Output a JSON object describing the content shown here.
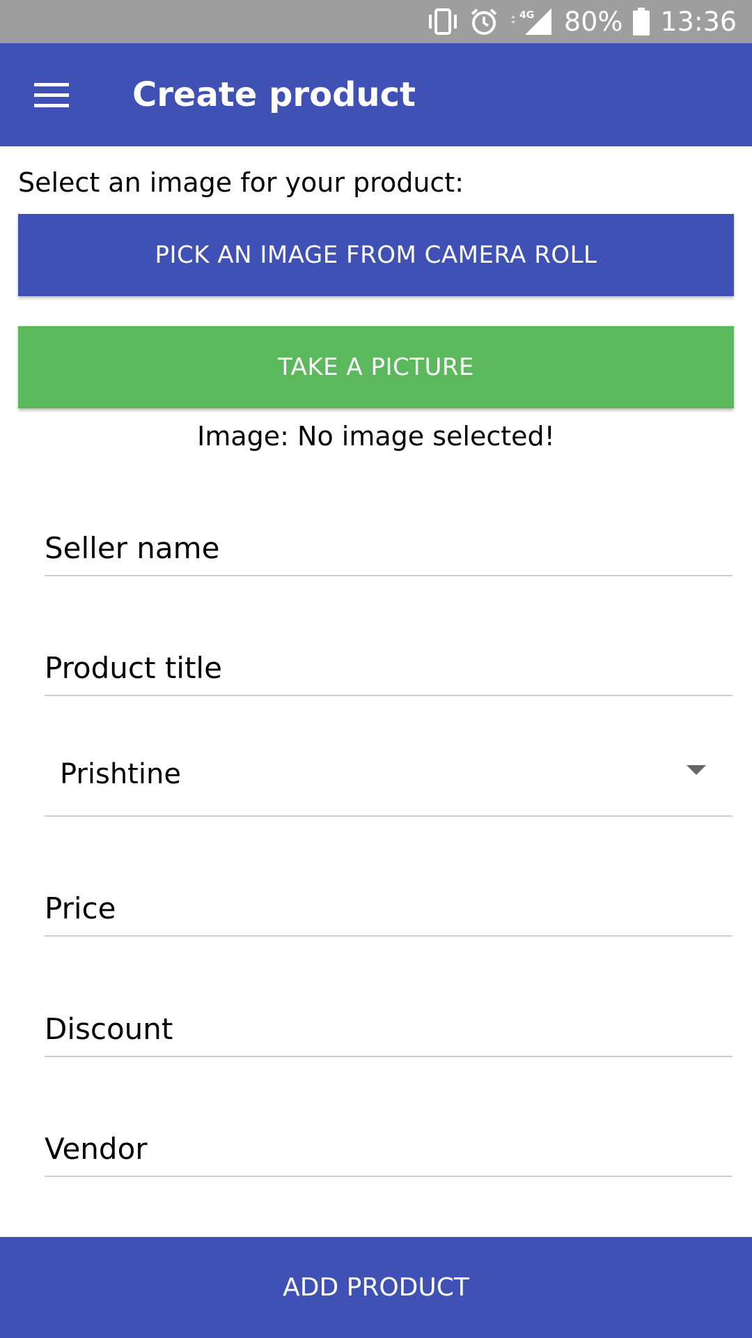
{
  "status_bar": {
    "battery": "80%",
    "time": "13:36",
    "network": "4G",
    "icons": [
      "vibrate-icon",
      "alarm-icon",
      "signal-icon",
      "battery-icon"
    ]
  },
  "app_bar": {
    "title": "Create product",
    "menu_icon": "hamburger-menu-icon",
    "color": "#3f51b5"
  },
  "image_section": {
    "label": "Select an image for your product:",
    "pick_button": "PICK AN IMAGE FROM CAMERA ROLL",
    "take_button": "TAKE A PICTURE",
    "status": "Image: No image selected!"
  },
  "form": {
    "seller_name": {
      "placeholder": "Seller name",
      "value": ""
    },
    "product_title": {
      "placeholder": "Product title",
      "value": ""
    },
    "city": {
      "selected": "Prishtine"
    },
    "price": {
      "placeholder": "Price",
      "value": ""
    },
    "discount": {
      "placeholder": "Discount",
      "value": ""
    },
    "vendor": {
      "placeholder": "Vendor",
      "value": ""
    }
  },
  "footer": {
    "add_button": "ADD PRODUCT"
  },
  "colors": {
    "primary": "#3f51b5",
    "success": "#5cb85c",
    "status_bar": "#9e9e9e"
  }
}
